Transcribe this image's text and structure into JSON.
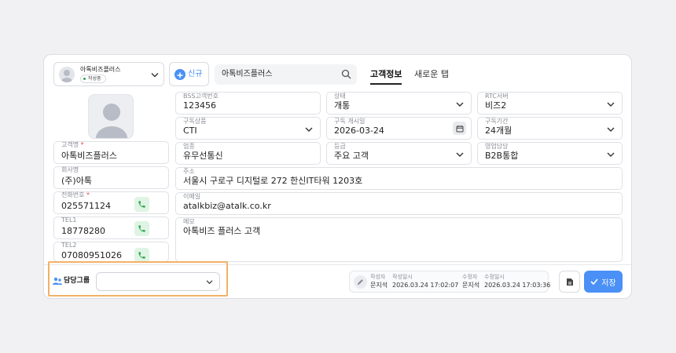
{
  "company_select": {
    "name": "아톡비즈플러스",
    "badge": "작성중"
  },
  "new_button": {
    "label": "신규"
  },
  "search": {
    "value": "아톡비즈플러스"
  },
  "tabs": [
    {
      "label": "고객정보",
      "active": true
    },
    {
      "label": "새로운 탭",
      "active": false
    }
  ],
  "left_fields": {
    "customer_name": {
      "label": "고객명",
      "required": "*",
      "value": "아톡비즈플러스"
    },
    "company_name": {
      "label": "회사명",
      "value": "(주)아톡"
    },
    "phone": {
      "label": "전화번호",
      "required": "*",
      "value": "025571124"
    },
    "tel1": {
      "label": "TEL1",
      "value": "18778280"
    },
    "tel2": {
      "label": "TEL2",
      "value": "07080951026"
    }
  },
  "grid_fields": {
    "bss_id": {
      "label": "BSS고객번호",
      "value": "123456"
    },
    "status": {
      "label": "상태",
      "value": "개통"
    },
    "rtc_server": {
      "label": "RTC서버",
      "value": "비즈2"
    },
    "product": {
      "label": "구독상품",
      "value": "CTI"
    },
    "start_date": {
      "label": "구독 개시일",
      "value": "2026-03-24"
    },
    "period": {
      "label": "구독기간",
      "value": "24개월"
    },
    "industry": {
      "label": "업종",
      "value": "유무선통신"
    },
    "grade": {
      "label": "등급",
      "value": "주요 고객"
    },
    "sales": {
      "label": "영업담당",
      "value": "B2B통합"
    },
    "address": {
      "label": "주소",
      "value": "서울시 구로구 디지털로 272 한신IT타워 1203호"
    },
    "email": {
      "label": "이메일",
      "value": "atalkbiz@atalk.co.kr"
    },
    "memo": {
      "label": "메모",
      "value": "아톡비즈 플러스 고객"
    }
  },
  "group": {
    "label": "담당그룹",
    "value": ""
  },
  "meta": {
    "author_label": "작성자",
    "author": "문지석",
    "created_label": "작성일시",
    "created": "2026.03.24 17:02:07",
    "editor_label": "수정자",
    "editor": "문지석",
    "modified_label": "수정일시",
    "modified": "2026.03.24 17:03:36"
  },
  "save_button": {
    "label": "저장"
  },
  "colors": {
    "accent": "#4a90f7",
    "highlight": "#f2b166",
    "phone_bg": "#dff4e4",
    "phone_icon": "#2fa84f",
    "required": "#e5484d"
  }
}
